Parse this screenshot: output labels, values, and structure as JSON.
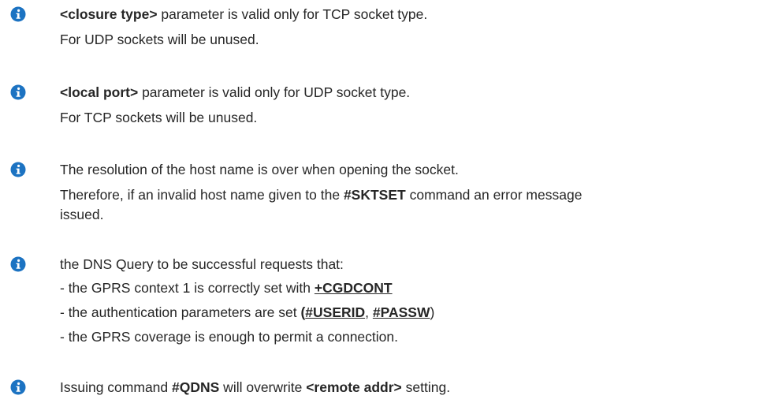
{
  "colors": {
    "icon": "#1c73c2",
    "text": "#262626"
  },
  "icon_name": "info-icon",
  "notes": [
    {
      "lines": [
        {
          "bold_1": "<closure type>",
          "text_1": " parameter is valid only for TCP socket type."
        },
        {
          "text_1": "For UDP sockets will be unused."
        }
      ]
    },
    {
      "lines": [
        {
          "bold_1": "<local port>",
          "text_1": " parameter is valid only for UDP socket type."
        },
        {
          "text_1": "For TCP sockets will be unused."
        }
      ]
    },
    {
      "lines": [
        {
          "text_1": "The resolution of the host name is over when opening the socket."
        },
        {
          "text_1": "Therefore, if an invalid host name given to the ",
          "bold_1": "#SKTSET",
          "text_2": " command an error message"
        },
        {
          "text_1": "issued."
        }
      ]
    },
    {
      "lines": [
        {
          "text_1": "the DNS Query to be successful requests that:"
        },
        {
          "text_1": "- the GPRS context 1 is correctly set with ",
          "link_1": "+CGDCONT"
        },
        {
          "text_1": "- the authentication parameters are set ",
          "bold_1": "(",
          "link_1": "#USERID",
          "text_2": ", ",
          "link_2": "#PASSW",
          "text_3": ")"
        },
        {
          "text_1": "- the GPRS coverage is enough to permit a connection."
        }
      ]
    },
    {
      "lines": [
        {
          "text_1": "Issuing command ",
          "bold_1": "#QDNS",
          "text_2": " will overwrite ",
          "bold_2": "<remote addr>",
          "text_3": " setting."
        }
      ]
    }
  ]
}
